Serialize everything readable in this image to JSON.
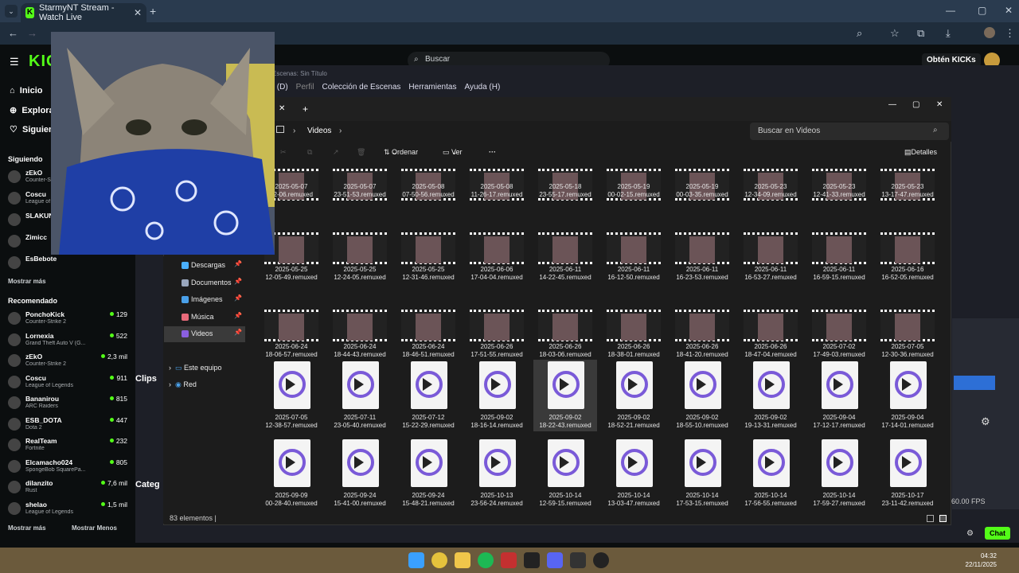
{
  "browser": {
    "tab_title": "StarmyNT Stream - Watch Live",
    "favicon": "K",
    "url": "kick.com/starmynt"
  },
  "kick": {
    "search_placeholder": "Buscar",
    "get_kicks": "Obtén KICKs",
    "nav": [
      "Inicio",
      "Explorar",
      "Siguiendo"
    ],
    "following_title": "Siguiendo",
    "following": [
      {
        "name": "zEkO",
        "game": "Counter-Strike 2"
      },
      {
        "name": "Coscu",
        "game": "League of Legends"
      },
      {
        "name": "SLAKUN",
        "game": ""
      },
      {
        "name": "Zimicc",
        "game": ""
      },
      {
        "name": "EsBebote",
        "game": ""
      }
    ],
    "show_more": "Mostrar más",
    "recommended_title": "Recomendado",
    "recommended": [
      {
        "name": "PonchoKick",
        "game": "Counter-Strike 2",
        "viewers": "129"
      },
      {
        "name": "Lornexia",
        "game": "Grand Theft Auto V (G...",
        "viewers": "522"
      },
      {
        "name": "zEkO",
        "game": "Counter-Strike 2",
        "viewers": "2,3 mil"
      },
      {
        "name": "Coscu",
        "game": "League of Legends",
        "viewers": "911"
      },
      {
        "name": "Bananirou",
        "game": "ARC Raiders",
        "viewers": "815"
      },
      {
        "name": "ESB_DOTA",
        "game": "Dota 2",
        "viewers": "447"
      },
      {
        "name": "RealTeam",
        "game": "Fortnite",
        "viewers": "232"
      },
      {
        "name": "Elcamacho024",
        "game": "SpongeBob SquarePa...",
        "viewers": "805"
      },
      {
        "name": "dilanzito",
        "game": "Rust",
        "viewers": "7,6 mil"
      },
      {
        "name": "shelao",
        "game": "League of Legends",
        "viewers": "1,5 mil"
      }
    ],
    "show_more2": "Mostrar más",
    "show_less": "Mostrar Menos",
    "clips_label": "Clips",
    "categories_label": "Categ",
    "chat_btn": "Chat"
  },
  "obs": {
    "title": "Escenas: Sin Título",
    "menu": [
      "s (D)",
      "Perfil",
      "Colección de Escenas",
      "Herramientas",
      "Ayuda (H)"
    ],
    "fps": "60.00 FPS"
  },
  "explorer": {
    "breadcrumb": "Videos",
    "search_placeholder": "Buscar en Videos",
    "sort": "Ordenar",
    "view": "Ver",
    "details": "Detalles",
    "nav": [
      {
        "label": "Descargas",
        "color": "#4ab0ff"
      },
      {
        "label": "Documentos",
        "color": "#9aa7bd"
      },
      {
        "label": "Imágenes",
        "color": "#4aa0e8"
      },
      {
        "label": "Música",
        "color": "#e86a7a"
      },
      {
        "label": "Videos",
        "color": "#8a5fe0"
      }
    ],
    "tree": [
      "Este equipo",
      "Red"
    ],
    "status": "83 elementos",
    "rows": [
      {
        "kind": "thumb",
        "files": [
          [
            "2025-05-07",
            "22-06.remuxed"
          ],
          [
            "2025-05-07",
            "23-51-53.remuxed"
          ],
          [
            "2025-05-08",
            "07-50-56.remuxed"
          ],
          [
            "2025-05-08",
            "11-26-17.remuxed"
          ],
          [
            "2025-05-18",
            "23-55-17.remuxed"
          ],
          [
            "2025-05-19",
            "00-02-15.remuxed"
          ],
          [
            "2025-05-19",
            "00-03-35.remuxed"
          ],
          [
            "2025-05-23",
            "12-34-09.remuxed"
          ],
          [
            "2025-05-23",
            "12-41-33.remuxed"
          ],
          [
            "2025-05-23",
            "13-17-47.remuxed"
          ]
        ]
      },
      {
        "kind": "thumb",
        "files": [
          [
            "2025-05-25",
            "12-05-49.remuxed"
          ],
          [
            "2025-05-25",
            "12-24-05.remuxed"
          ],
          [
            "2025-05-25",
            "12-31-46.remuxed"
          ],
          [
            "2025-06-06",
            "17-04-04.remuxed"
          ],
          [
            "2025-06-11",
            "14-22-45.remuxed"
          ],
          [
            "2025-06-11",
            "16-12-50.remuxed"
          ],
          [
            "2025-06-11",
            "16-23-53.remuxed"
          ],
          [
            "2025-06-11",
            "16-53-27.remuxed"
          ],
          [
            "2025-06-11",
            "16-59-15.remuxed"
          ],
          [
            "2025-06-16",
            "16-52-05.remuxed"
          ]
        ]
      },
      {
        "kind": "thumb",
        "files": [
          [
            "2025-06-24",
            "18-06-57.remuxed"
          ],
          [
            "2025-06-24",
            "18-44-43.remuxed"
          ],
          [
            "2025-06-24",
            "18-46-51.remuxed"
          ],
          [
            "2025-06-26",
            "17-51-55.remuxed"
          ],
          [
            "2025-06-26",
            "18-03-06.remuxed"
          ],
          [
            "2025-06-26",
            "18-38-01.remuxed"
          ],
          [
            "2025-06-26",
            "18-41-20.remuxed"
          ],
          [
            "2025-06-26",
            "18-47-04.remuxed"
          ],
          [
            "2025-07-02",
            "17-49-03.remuxed"
          ],
          [
            "2025-07-05",
            "12-30-36.remuxed"
          ]
        ]
      },
      {
        "kind": "icon",
        "files": [
          [
            "2025-07-05",
            "12-38-57.remuxed"
          ],
          [
            "2025-07-11",
            "23-05-40.remuxed"
          ],
          [
            "2025-07-12",
            "15-22-29.remuxed"
          ],
          [
            "2025-09-02",
            "18-16-14.remuxed"
          ],
          [
            "2025-09-02",
            "18-22-43.remuxed"
          ],
          [
            "2025-09-02",
            "18-52-21.remuxed"
          ],
          [
            "2025-09-02",
            "18-55-10.remuxed"
          ],
          [
            "2025-09-02",
            "19-13-31.remuxed"
          ],
          [
            "2025-09-04",
            "17-12-17.remuxed"
          ],
          [
            "2025-09-04",
            "17-14-01.remuxed"
          ]
        ]
      },
      {
        "kind": "icon",
        "files": [
          [
            "2025-09-09",
            "00-28-40.remuxed"
          ],
          [
            "2025-09-24",
            "15-41-00.remuxed"
          ],
          [
            "2025-09-24",
            "15-48-21.remuxed"
          ],
          [
            "2025-10-13",
            "23-56-24.remuxed"
          ],
          [
            "2025-10-14",
            "12-59-15.remuxed"
          ],
          [
            "2025-10-14",
            "13-03-47.remuxed"
          ],
          [
            "2025-10-14",
            "17-53-15.remuxed"
          ],
          [
            "2025-10-14",
            "17-56-55.remuxed"
          ],
          [
            "2025-10-14",
            "17-59-27.remuxed"
          ],
          [
            "2025-10-17",
            "23-11-42.remuxed"
          ]
        ]
      }
    ],
    "selected_file": "2025-09-02 18-22-43.remuxed"
  },
  "taskbar": {
    "time": "04:32",
    "date": "22/11/2025"
  }
}
